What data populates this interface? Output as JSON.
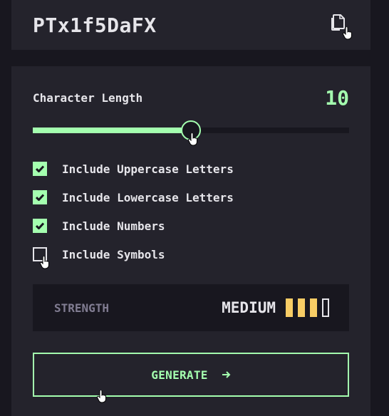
{
  "output": {
    "password": "PTx1f5DaFX",
    "copy_icon": "copy-icon"
  },
  "length": {
    "label": "Character Length",
    "value": "10",
    "slider_fraction": 0.5
  },
  "options": [
    {
      "label": "Include Uppercase Letters",
      "checked": true
    },
    {
      "label": "Include Lowercase Letters",
      "checked": true
    },
    {
      "label": "Include Numbers",
      "checked": true
    },
    {
      "label": "Include Symbols",
      "checked": false
    }
  ],
  "strength": {
    "label": "STRENGTH",
    "level": "MEDIUM",
    "bars_filled": 3,
    "bars_total": 4
  },
  "generate": {
    "label": "GENERATE",
    "icon": "arrow-right-icon"
  },
  "colors": {
    "accent": "#a4ffaf",
    "medium": "#f8cd65",
    "panel": "#24232c",
    "background": "#18171f",
    "text": "#e6e5ea",
    "muted": "#817d92"
  }
}
